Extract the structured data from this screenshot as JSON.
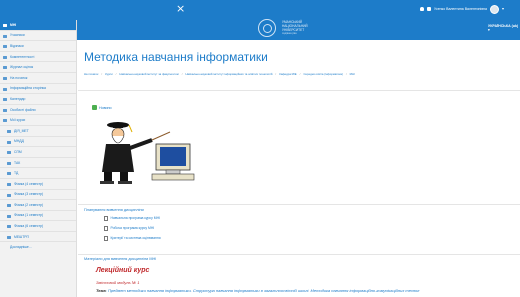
{
  "topbar": {
    "close_glyph": "×",
    "user_name": "Усенко Валентина Валентинівна",
    "language": "УКРАЇНСЬКА (uk) ▾",
    "university": [
      "УМАНСЬКИЙ",
      "НАЦІОНАЛЬНИЙ",
      "УНІВЕРСИТЕТ"
    ],
    "university_sub": "садівництва"
  },
  "sidebar": {
    "items": [
      {
        "label": "МНІ",
        "active": true,
        "indent": false
      },
      {
        "label": "Учасники",
        "indent": false
      },
      {
        "label": "Відзнаки",
        "indent": false
      },
      {
        "label": "Компетентності",
        "indent": false
      },
      {
        "label": "Журнал оцінок",
        "indent": false
      },
      {
        "label": "На початок",
        "indent": false
      },
      {
        "label": "Інформаційна сторінка",
        "indent": false
      },
      {
        "label": "Календар",
        "indent": false
      },
      {
        "label": "Особисті файли",
        "indent": false
      },
      {
        "label": "Мої курси",
        "indent": false
      },
      {
        "label": "ДІЯ_МЕТ",
        "indent": true
      },
      {
        "label": "МНДД",
        "indent": true
      },
      {
        "label": "СПМ",
        "indent": true
      },
      {
        "label": "ТАК",
        "indent": true
      },
      {
        "label": "ТД",
        "indent": true
      },
      {
        "label": "Фізика (4 семестр)",
        "indent": true
      },
      {
        "label": "Фізика (3 семестр)",
        "indent": true
      },
      {
        "label": "Фізика (2 семестр)",
        "indent": true
      },
      {
        "label": "Фізика (1 семестр)",
        "indent": true
      },
      {
        "label": "Фізика (6 семестр)",
        "indent": true
      },
      {
        "label": "МЕШТРП",
        "indent": true
      }
    ],
    "more": "Докладніше..."
  },
  "page": {
    "title": "Методика навчання інформатики",
    "breadcrumb": [
      "На початок",
      "Курси",
      "Навчально-науковий інститут за факультетом",
      "Навчально-науковий інститут інформаційних та освітніх технологій",
      "Кафедра МІЕ",
      "Середня освіта (Інформатика)",
      "МНІ"
    ]
  },
  "news": {
    "label": "Новини"
  },
  "planning": {
    "title": "Планування вивчення дисципліни",
    "items": [
      "Навчальна програма курсу МНІ",
      "Робоча програма курсу МНІ",
      "Критерії та система оцінювання"
    ]
  },
  "materials": {
    "title": "Матеріали для вивчення дисципліни МНІ",
    "lecture_heading": "Лекційний курс",
    "module": "Змістовий модуль № 1",
    "topic_label": "Тема",
    "topic_text": "Предмет методики навчання інформатики. Структура навчання інформатики в загальноосвітній школі. Методика навчання інформаційно-комунікаційних технол"
  },
  "colors": {
    "accent": "#1d7cc9",
    "lecture_red": "#c0282b",
    "sidebar_bg": "#f2f2f2"
  }
}
